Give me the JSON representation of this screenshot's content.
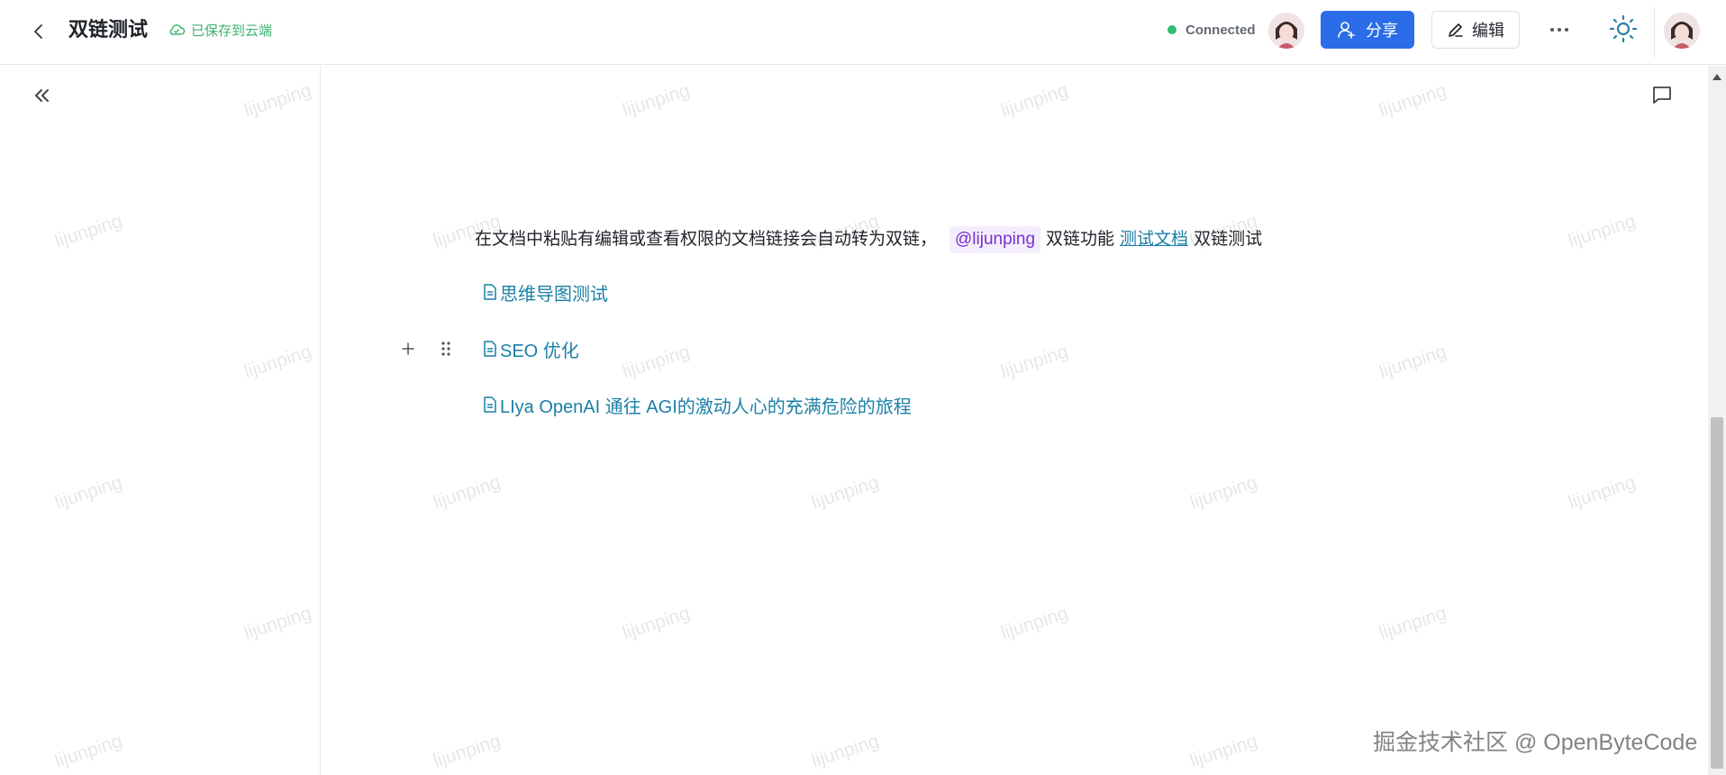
{
  "header": {
    "title": "双链测试",
    "save_status": "已保存到云端",
    "connection": "Connected",
    "share_label": "分享",
    "edit_label": "编辑"
  },
  "content": {
    "paragraph_text": "在文档中粘贴有编辑或查看权限的文档链接会自动转为双链，",
    "mention": "@lijunping",
    "after_mention": "双链功能",
    "inline_link": "测试文档",
    "after_link": "双链测试",
    "doc_links": [
      "思维导图测试",
      "SEO 优化",
      "LIya OpenAI 通往 AGI的激动人心的充满危险的旅程"
    ]
  },
  "watermark": {
    "text": "lijunping",
    "footer": "掘金技术社区 @ OpenByteCode"
  },
  "colors": {
    "primary": "#2b6de8",
    "saved": "#3cb371",
    "connected_dot": "#2fbf71",
    "link": "#1b7fa6",
    "mention": "#7b2fd0"
  },
  "icons": {
    "back": "chevron-left-icon",
    "saved": "cloud-icon",
    "share": "user-plus-icon",
    "edit": "pencil-icon",
    "more": "more-horizontal-icon",
    "theme": "sun-icon",
    "collapse": "double-chevron-left-icon",
    "comment": "comment-icon",
    "doc": "document-icon"
  }
}
